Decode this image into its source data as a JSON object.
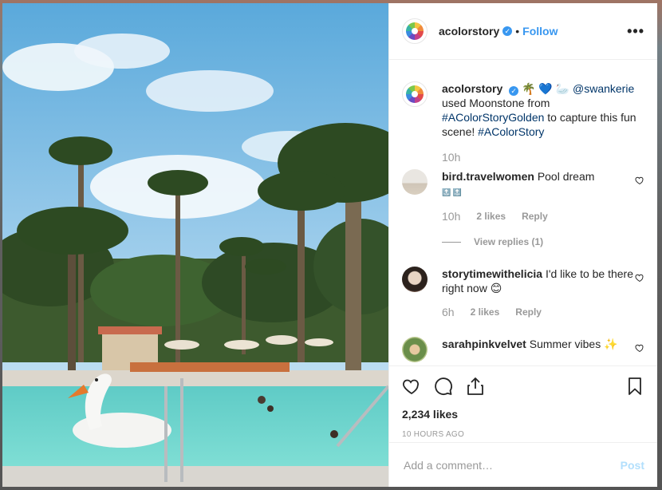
{
  "post": {
    "username": "acolorstory",
    "follow_label": "Follow",
    "separator": "•",
    "more_label": "•••",
    "verified_glyph": "✓",
    "caption": {
      "username": "acolorstory",
      "emojis": "🌴 💙 🦢",
      "mention": "@swankerie",
      "text_1": "used Moonstone from",
      "hashtag_1": "#AColorStoryGolden",
      "text_2": "to capture this fun scene!",
      "hashtag_2": "#AColorStory",
      "time": "10h"
    },
    "comments": [
      {
        "username": "bird.travelwomen",
        "text": "Pool dream",
        "extra": "🔝 🔝",
        "time": "10h",
        "likes": "2 likes",
        "reply": "Reply",
        "view_replies": "View replies (1)"
      },
      {
        "username": "storytimewithelicia",
        "text": "I'd like to be there right now 😊",
        "time": "6h",
        "likes": "2 likes",
        "reply": "Reply"
      },
      {
        "username": "sarahpinkvelvet",
        "text": "Summer vibes ✨"
      }
    ],
    "likes_count": "2,234 likes",
    "posted_ago": "10 HOURS AGO",
    "comment_placeholder": "Add a comment…",
    "post_label": "Post"
  },
  "colors": {
    "accent": "#3897f0",
    "post_disabled": "#b2dffc",
    "muted": "#999999"
  },
  "icons": [
    "more-options-icon",
    "verified-badge-icon",
    "heart-icon",
    "comment-icon",
    "share-icon",
    "bookmark-icon"
  ]
}
